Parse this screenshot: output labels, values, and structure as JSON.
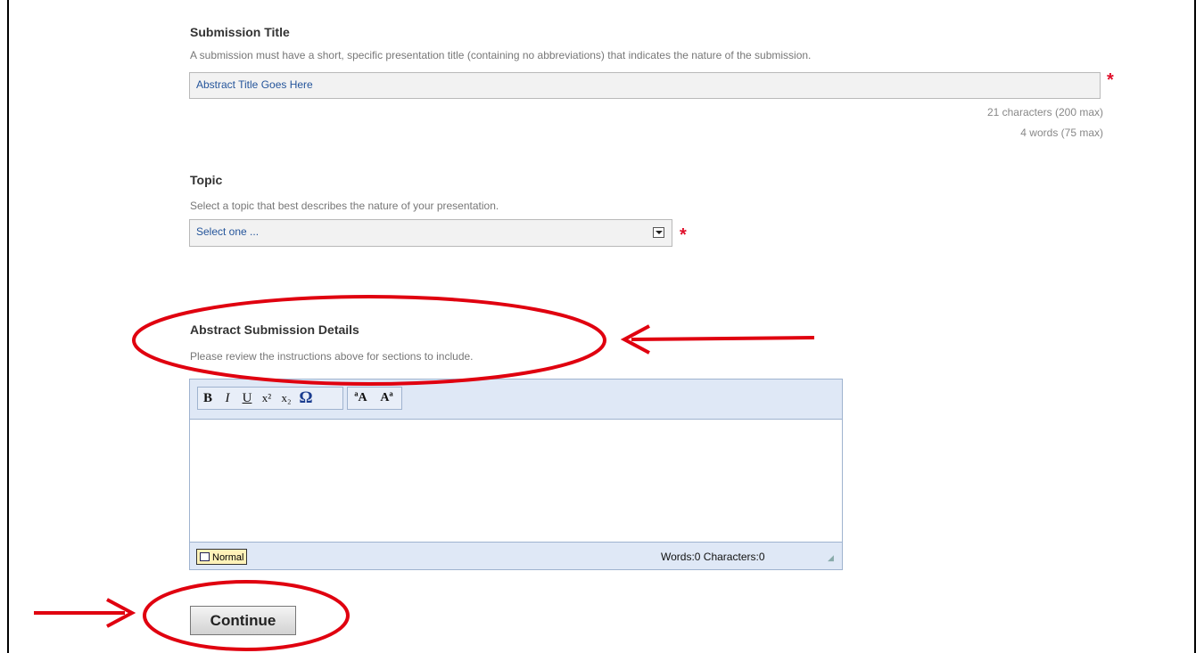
{
  "submission_title": {
    "heading": "Submission Title",
    "description": "A submission must have a short, specific presentation title (containing no abbreviations) that indicates the nature of the submission.",
    "value": "Abstract Title Goes Here",
    "required_mark": "*",
    "char_count": "21 characters (200 max)",
    "word_count": "4 words (75 max)"
  },
  "topic": {
    "heading": "Topic",
    "description": "Select a topic that best describes the nature of your presentation.",
    "selected": "Select one ...",
    "required_mark": "*"
  },
  "abstract": {
    "heading": "Abstract Submission Details",
    "description": "Please review the instructions above for sections to include.",
    "toolbar": {
      "bold": "B",
      "italic": "I",
      "underline": "U",
      "superscript": "x²",
      "subscript": "x₂",
      "special_char": "Ω",
      "decrease_font": "ªA",
      "increase_font": "Aª"
    },
    "format_label": "Normal",
    "counter": "Words:0 Characters:0"
  },
  "continue_label": "Continue",
  "annotation_color": "#e0000f"
}
